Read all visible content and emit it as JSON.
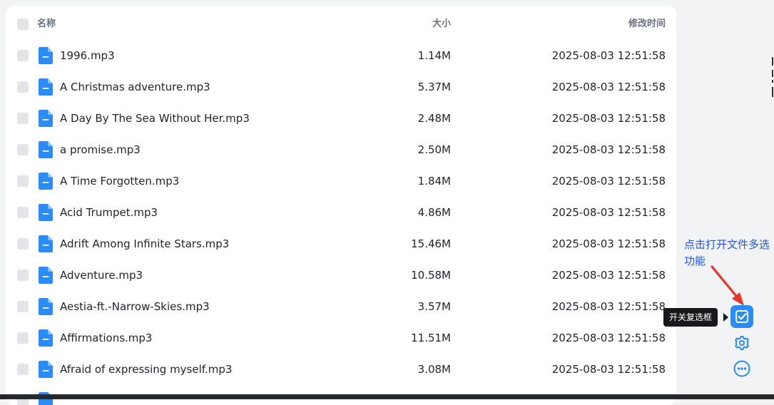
{
  "table": {
    "header": {
      "name": "名称",
      "size": "大小",
      "modified": "修改时间"
    },
    "rows": [
      {
        "name": "1996.mp3",
        "size": "1.14M",
        "modified": "2025-08-03 12:51:58"
      },
      {
        "name": "A Christmas adventure.mp3",
        "size": "5.37M",
        "modified": "2025-08-03 12:51:58"
      },
      {
        "name": "A Day By The Sea Without Her.mp3",
        "size": "2.48M",
        "modified": "2025-08-03 12:51:58"
      },
      {
        "name": "a promise.mp3",
        "size": "2.50M",
        "modified": "2025-08-03 12:51:58"
      },
      {
        "name": "A Time Forgotten.mp3",
        "size": "1.84M",
        "modified": "2025-08-03 12:51:58"
      },
      {
        "name": "Acid Trumpet.mp3",
        "size": "4.86M",
        "modified": "2025-08-03 12:51:58"
      },
      {
        "name": "Adrift Among Infinite Stars.mp3",
        "size": "15.46M",
        "modified": "2025-08-03 12:51:58"
      },
      {
        "name": "Adventure.mp3",
        "size": "10.58M",
        "modified": "2025-08-03 12:51:58"
      },
      {
        "name": "Aestia-ft.-Narrow-Skies.mp3",
        "size": "3.57M",
        "modified": "2025-08-03 12:51:58"
      },
      {
        "name": "Affirmations.mp3",
        "size": "11.51M",
        "modified": "2025-08-03 12:51:58"
      },
      {
        "name": "Afraid of expressing myself.mp3",
        "size": "3.08M",
        "modified": "2025-08-03 12:51:58"
      }
    ]
  },
  "toolbar": {
    "checkbox_toggle_icon": "checkbox-icon",
    "checkbox_toggle_tooltip": "开关复选框",
    "settings_icon": "gear-icon",
    "more_icon": "more-icon"
  },
  "annotation": {
    "text": "点击打开文件多选功能"
  },
  "colors": {
    "accent": "#2a8cf8",
    "file_icon": "#2a8cf8",
    "annotation_text": "#2557d6",
    "annotation_arrow": "#e8352b",
    "tooltip_bg": "#16181c"
  }
}
